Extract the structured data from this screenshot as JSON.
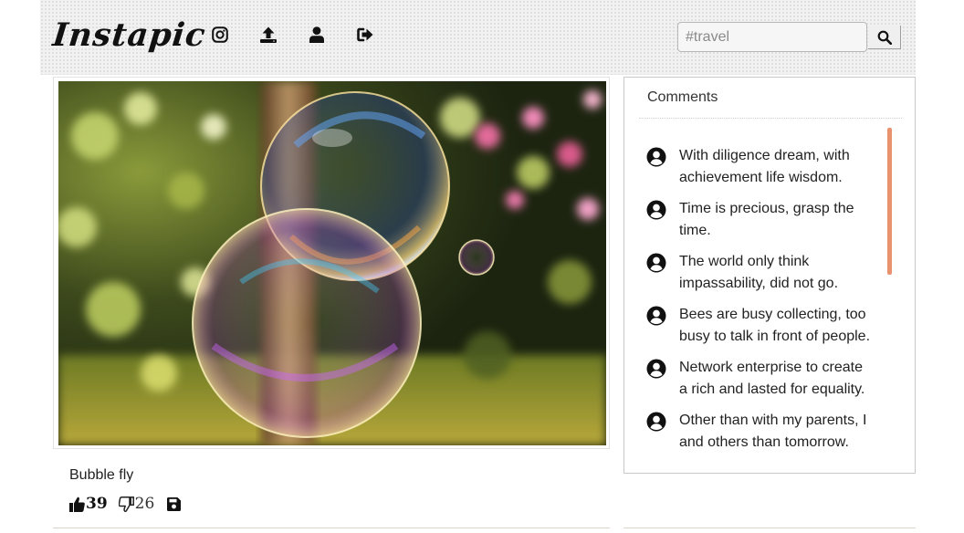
{
  "header": {
    "logo_text": "Instapic",
    "nav": [
      {
        "icon": "instagram-icon"
      },
      {
        "icon": "upload-icon"
      },
      {
        "icon": "user-icon"
      },
      {
        "icon": "sign-out-icon"
      }
    ],
    "search": {
      "placeholder": "#travel",
      "icon": "search-icon"
    }
  },
  "post": {
    "image": "soap bubbles in a garden",
    "caption": "Bubble fly",
    "likes": "39",
    "dislikes": "26",
    "icons": {
      "like": "thumbs-up-icon",
      "dislike": "thumbs-down-icon",
      "save": "save-icon"
    }
  },
  "comments": {
    "title": "Comments",
    "items": [
      {
        "text": "With diligence dream, with achievement life wisdom."
      },
      {
        "text": "Time is precious, grasp the time."
      },
      {
        "text": "The world only think impassability, did not go."
      },
      {
        "text": "Bees are busy collecting, too busy to talk in front of people."
      },
      {
        "text": "Network enterprise to create a rich and lasted for equality."
      },
      {
        "text": "Other than with my parents, I and others than tomorrow."
      }
    ]
  },
  "colors": {
    "scrollbar": "#e8926e",
    "header_bg": "#f1f1f1"
  }
}
